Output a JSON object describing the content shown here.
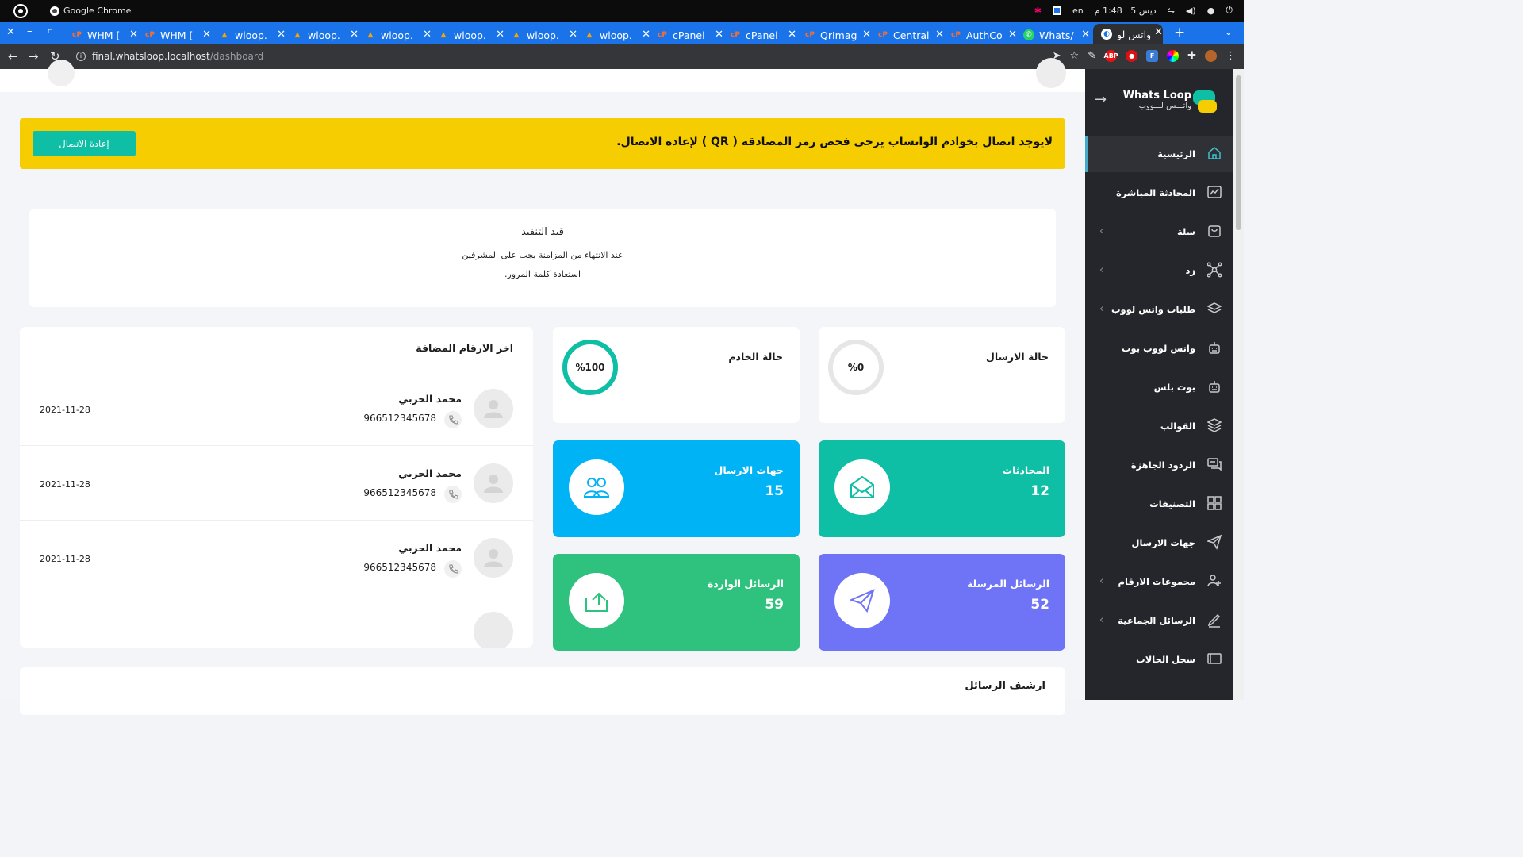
{
  "os": {
    "app_name": "Google Chrome",
    "lang": "en",
    "date": "ديس 5",
    "time": "1:48 م"
  },
  "tabs": [
    {
      "title": "WHM [",
      "icon": "cpanel-icon"
    },
    {
      "title": "WHM [",
      "icon": "cpanel-icon"
    },
    {
      "title": "wloop.",
      "icon": "wloop-icon"
    },
    {
      "title": "wloop.",
      "icon": "wloop-icon"
    },
    {
      "title": "wloop.",
      "icon": "wloop-icon"
    },
    {
      "title": "wloop.",
      "icon": "wloop-icon"
    },
    {
      "title": "wloop.",
      "icon": "wloop-icon"
    },
    {
      "title": "wloop.",
      "icon": "wloop-icon"
    },
    {
      "title": "cPanel",
      "icon": "cpanel-icon"
    },
    {
      "title": "cPanel",
      "icon": "cpanel-icon"
    },
    {
      "title": "QrImag",
      "icon": "cpanel-icon"
    },
    {
      "title": "Central",
      "icon": "cpanel-icon"
    },
    {
      "title": "AuthCo",
      "icon": "cpanel-icon"
    },
    {
      "title": "Whats/",
      "icon": "whatsapp-icon"
    },
    {
      "title": "واتس لو",
      "icon": "globe-icon"
    }
  ],
  "address": {
    "host": "final.whatsloop.localhost",
    "path": "/dashboard"
  },
  "alert": {
    "message": "لايوجد اتصال بخوادم الواتساب يرجى فحص رمز المصادقة ( QR ) لإعادة الاتصال.",
    "button": "إعادة الاتصال"
  },
  "notice": {
    "title": "قيد التنفيذ",
    "line1": "عند الانتهاء من المزامنة يجب على المشرفين",
    "line2": "استعادة كلمة المرور."
  },
  "status": {
    "send": {
      "title": "حالة الارسال",
      "value": "%0",
      "progress": 0
    },
    "server": {
      "title": "حالة الخادم",
      "value": "%100",
      "progress": 100
    }
  },
  "tiles": {
    "conversations": {
      "title": "المحادثات",
      "value": "12"
    },
    "contacts": {
      "title": "جهات الارسال",
      "value": "15"
    },
    "sent": {
      "title": "الرسائل المرسلة",
      "value": "52"
    },
    "incoming": {
      "title": "الرسائل الواردة",
      "value": "59"
    }
  },
  "recent": {
    "title": "اخر الارقام المضافة",
    "rows": [
      {
        "name": "محمد الحربي",
        "phone": "966512345678",
        "date": "2021-11-28"
      },
      {
        "name": "محمد الحربي",
        "phone": "966512345678",
        "date": "2021-11-28"
      },
      {
        "name": "محمد الحربي",
        "phone": "966512345678",
        "date": "2021-11-28"
      }
    ]
  },
  "archive": {
    "title": "ارشيف الرسائل"
  },
  "brand": {
    "name": "Whats Loop",
    "name_ar": "واتـــس لـــووب"
  },
  "sidebar": {
    "items": [
      {
        "label": "الرئيسية"
      },
      {
        "label": "المحادثة المباشرة"
      },
      {
        "label": "سلة"
      },
      {
        "label": "زد"
      },
      {
        "label": "طلبات واتس لووب"
      },
      {
        "label": "واتس لووب بوت"
      },
      {
        "label": "بوت بلس"
      },
      {
        "label": "القوالب"
      },
      {
        "label": "الردود الجاهزة"
      },
      {
        "label": "التصنيفات"
      },
      {
        "label": "جهات الارسال"
      },
      {
        "label": "مجموعات الارقام"
      },
      {
        "label": "الرسائل الجماعية"
      },
      {
        "label": "سجل الحالات"
      }
    ]
  },
  "colors": {
    "alert": "#f5cd00",
    "teal": "#0ebfa6",
    "blue": "#00b3f5",
    "green": "#2ec27e",
    "purple": "#6f74f7",
    "sidebar": "#25262b"
  }
}
